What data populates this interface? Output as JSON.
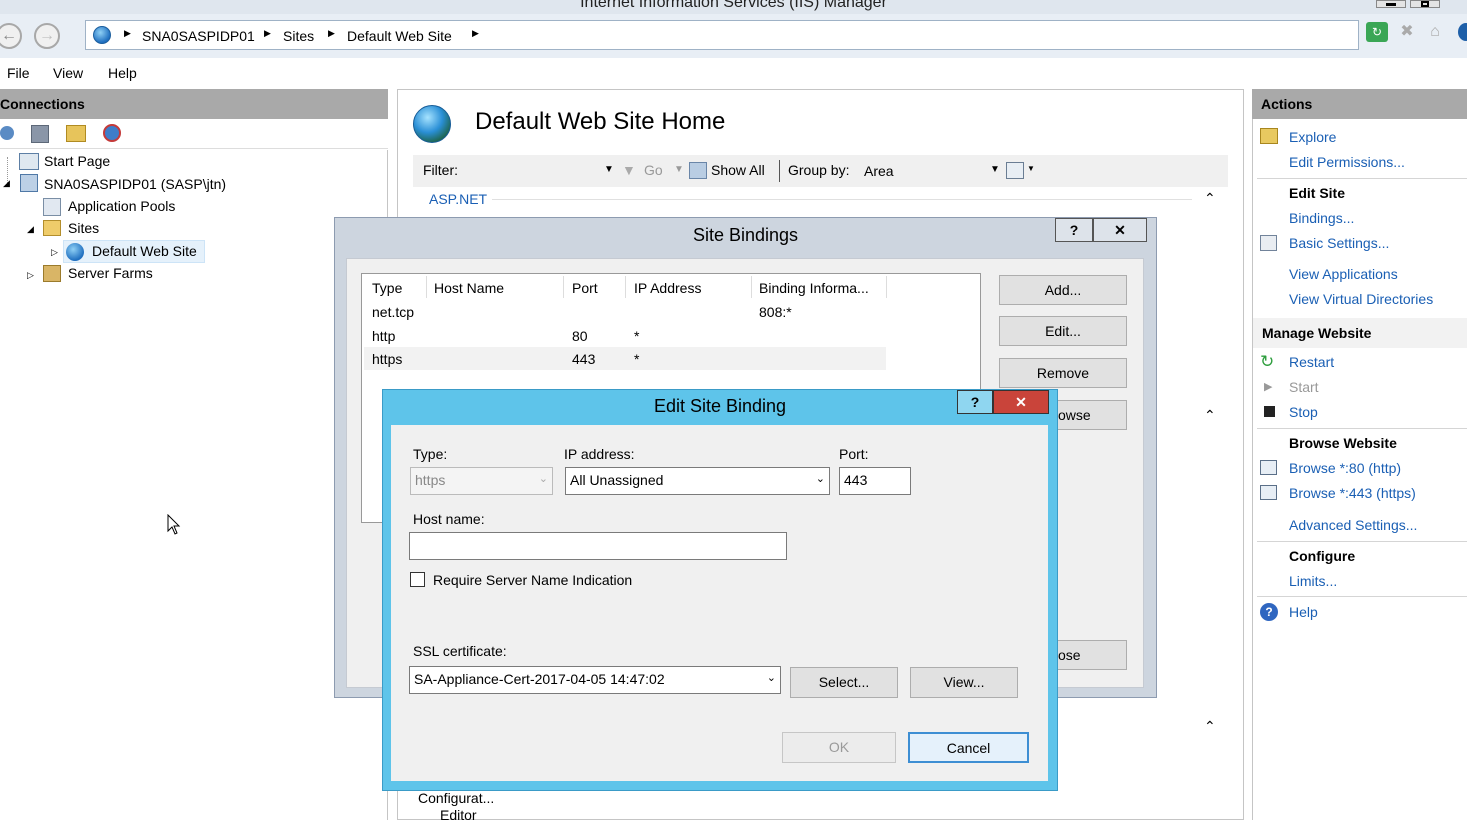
{
  "window": {
    "title": "Internet Information Services (IIS) Manager"
  },
  "breadcrumb": [
    "SNA0SASPIDP01",
    "Sites",
    "Default Web Site"
  ],
  "menu": [
    "File",
    "View",
    "Help"
  ],
  "connections": {
    "header": "Connections",
    "tree": [
      {
        "label": "Start Page"
      },
      {
        "label": "SNA0SASPIDP01 (SASP\\jtn)"
      },
      {
        "label": "Application Pools"
      },
      {
        "label": "Sites"
      },
      {
        "label": "Default Web Site"
      },
      {
        "label": "Server Farms"
      }
    ]
  },
  "center": {
    "title": "Default Web Site Home",
    "filter_label": "Filter:",
    "go_label": "Go",
    "show_all_label": "Show All",
    "group_by_label": "Group by:",
    "group_by_value": "Area",
    "section": "ASP.NET",
    "bottom_item_1": "Configurat...",
    "bottom_item_2": "Editor"
  },
  "actions": {
    "header": "Actions",
    "explore": "Explore",
    "edit_permissions": "Edit Permissions...",
    "edit_site": "Edit Site",
    "bindings": "Bindings...",
    "basic_settings": "Basic Settings...",
    "view_applications": "View Applications",
    "view_virtual_directories": "View Virtual Directories",
    "manage_website": "Manage Website",
    "restart": "Restart",
    "start": "Start",
    "stop": "Stop",
    "browse_website": "Browse Website",
    "browse_80": "Browse *:80 (http)",
    "browse_443": "Browse *:443 (https)",
    "advanced_settings": "Advanced Settings...",
    "configure": "Configure",
    "limits": "Limits...",
    "help": "Help"
  },
  "site_bindings": {
    "title": "Site Bindings",
    "help_glyph": "?",
    "close_glyph": "✕",
    "columns": [
      "Type",
      "Host Name",
      "Port",
      "IP Address",
      "Binding Informa..."
    ],
    "rows": [
      {
        "type": "net.tcp",
        "host": "",
        "port": "",
        "ip": "",
        "info": "808:*"
      },
      {
        "type": "http",
        "host": "",
        "port": "80",
        "ip": "*",
        "info": ""
      },
      {
        "type": "https",
        "host": "",
        "port": "443",
        "ip": "*",
        "info": ""
      }
    ],
    "add": "Add...",
    "edit": "Edit...",
    "remove": "Remove",
    "browse_partial": "owse",
    "close_partial": "ose"
  },
  "edit_binding": {
    "title": "Edit Site Binding",
    "help_glyph": "?",
    "close_glyph": "✕",
    "type_label": "Type:",
    "type_value": "https",
    "ip_label": "IP address:",
    "ip_value": "All Unassigned",
    "port_label": "Port:",
    "port_value": "443",
    "host_label": "Host name:",
    "host_value": "",
    "sni_label": "Require Server Name Indication",
    "sni_checked": false,
    "ssl_label": "SSL certificate:",
    "ssl_value": "SA-Appliance-Cert-2017-04-05 14:47:02",
    "select": "Select...",
    "view": "View...",
    "ok": "OK",
    "cancel": "Cancel"
  }
}
